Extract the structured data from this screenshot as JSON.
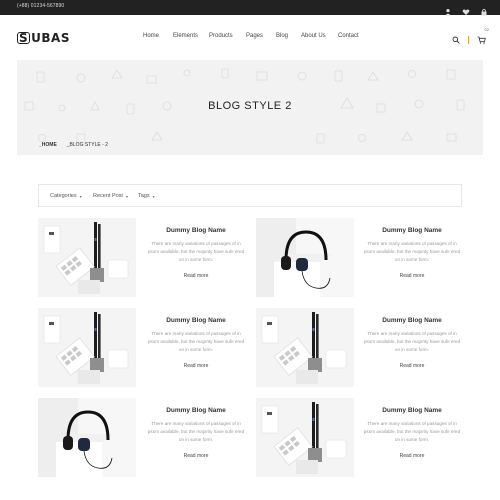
{
  "topbar": {
    "phone": "(+88) 01234-567890",
    "icons": [
      "user-icon",
      "heart-icon",
      "lock-icon"
    ]
  },
  "header": {
    "logo": "UBAS",
    "logo_mark": "S",
    "nav": [
      "Home",
      "Elements",
      "Products",
      "Pages",
      "Blog",
      "About Us",
      "Contact"
    ],
    "icons": [
      "search-icon",
      "cart-icon"
    ],
    "cart_count": "02",
    "accent": "#f0a050"
  },
  "hero": {
    "title": "BLOG STYLE 2",
    "breadcrumb_home": "_HOME",
    "breadcrumb_current": "_BLOG STYLE - 2"
  },
  "filters": [
    "Categories",
    "Recent Post",
    "Tags"
  ],
  "posts": [
    {
      "image": "stationery",
      "name": "Dummy Blog Name",
      "desc": "There are many variations of passages of in psum available, but the majority have sufe ered on in some form.",
      "more": "Read more"
    },
    {
      "image": "headphones",
      "name": "Dummy Blog Name",
      "desc": "There are many variations of passages of in psum available, but the majority have sufe ered on in some form.",
      "more": "Read more"
    },
    {
      "image": "stationery",
      "name": "Dummy Blog Name",
      "desc": "There are many variations of passages of in psum available, but the majority have sufe ered on in some form.",
      "more": "Read more"
    },
    {
      "image": "stationery",
      "name": "Dummy Blog Name",
      "desc": "There are many variations of passages of in psum available, but the majority have sufe ered on in some form.",
      "more": "Read more"
    },
    {
      "image": "headphones",
      "name": "Dummy Blog Name",
      "desc": "There are many variations of passages of in psum available, but the majority have sufe ered on in some form.",
      "more": "Read more"
    },
    {
      "image": "stationery",
      "name": "Dummy Blog Name",
      "desc": "There are many variations of passages of in psum available, but the majority have sufe ered on in some form.",
      "more": "Read more"
    }
  ]
}
